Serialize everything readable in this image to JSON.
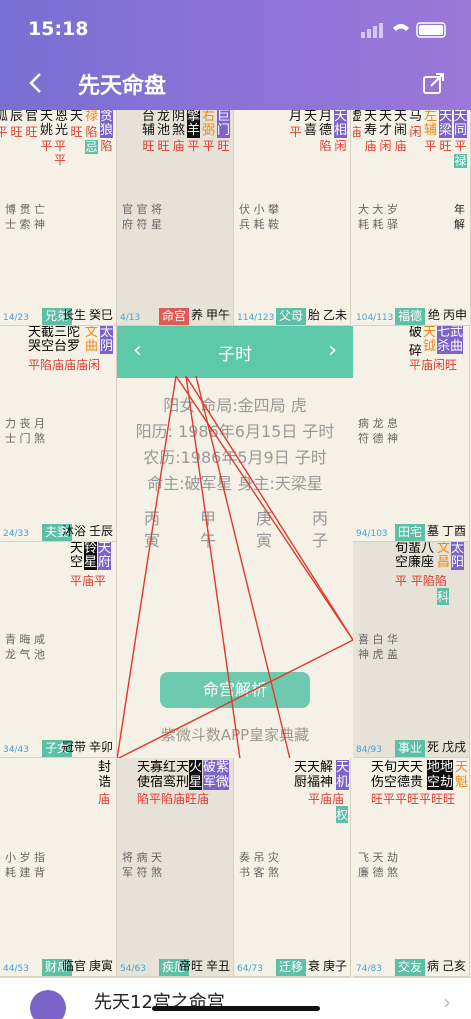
{
  "status": {
    "time": "15:18"
  },
  "nav": {
    "title": "先天命盘"
  },
  "cells": [
    {
      "id": "si",
      "col": 0,
      "row": 0,
      "dark": false,
      "stars": [
        {
          "n": "贪狼",
          "b": "陷",
          "cls": "hl"
        },
        {
          "n": "禄",
          "b": "陷",
          "cls": "org",
          "ex": "忌"
        },
        {
          "n": "天",
          "b": "旺"
        },
        {
          "n": "恩光",
          "b": "平平"
        },
        {
          "n": "天姚",
          "b": "平"
        },
        {
          "n": "官",
          "b": "旺"
        },
        {
          "n": "辰",
          "b": "旺"
        },
        {
          "n": "孤",
          "b": "平"
        },
        {
          "n": "巫",
          "b": "陷"
        }
      ],
      "gods": [
        "博 贯 亡",
        "士 索 神"
      ],
      "rgods": [],
      "age": "14/23",
      "palace": "兄弟",
      "state": "长生",
      "gz": "癸巳"
    },
    {
      "id": "wu",
      "col": 1,
      "row": 0,
      "dark": true,
      "stars": [
        {
          "n": "巨门",
          "b": "旺",
          "cls": "hl"
        },
        {
          "n": "右弼",
          "b": "平",
          "cls": "org"
        },
        {
          "n": "擎羊",
          "b": "平",
          "cls": "dk"
        },
        {
          "n": "阴煞",
          "b": "庙"
        },
        {
          "n": "龙池",
          "b": "旺"
        },
        {
          "n": "台辅",
          "b": "旺"
        }
      ],
      "gods": [
        "官 官 将",
        "府 符 星"
      ],
      "rgods": [],
      "age": "4/13",
      "palace": "命宫",
      "life": true,
      "state": "养",
      "gz": "甲午"
    },
    {
      "id": "wei",
      "col": 2,
      "row": 0,
      "dark": false,
      "stars": [
        {
          "n": "天相",
          "b": "闲",
          "cls": "hl"
        },
        {
          "n": "月德",
          "b": "陷"
        },
        {
          "n": "天喜",
          "b": ""
        },
        {
          "n": "月",
          "b": "平"
        }
      ],
      "gods": [
        "伏 小 攀",
        "兵 耗 鞍"
      ],
      "rgods": [],
      "age": "114/123",
      "palace": "父母",
      "state": "胎",
      "gz": "乙未"
    },
    {
      "id": "shen",
      "col": 3,
      "row": 0,
      "dark": false,
      "stars": [
        {
          "n": "天同",
          "b": "平",
          "cls": "hl",
          "ex": "禄"
        },
        {
          "n": "天梁",
          "b": "旺",
          "cls": "hl"
        },
        {
          "n": "左辅",
          "b": "平",
          "cls": "org"
        },
        {
          "n": "马",
          "b": "闲"
        },
        {
          "n": "天闹",
          "b": "庙"
        },
        {
          "n": "天才",
          "b": "闲"
        },
        {
          "n": "天寿",
          "b": "庙"
        },
        {
          "n": "虚",
          "b": "庙"
        }
      ],
      "gods": [
        "大 大 岁",
        "耗 耗 驿"
      ],
      "rgods": [
        "年",
        "解"
      ],
      "age": "104/113",
      "palace": "福德",
      "state": "绝",
      "gz": "丙申"
    }
  ],
  "center": {
    "hour": "子时",
    "l1": "阳女 命局:金四局 虎",
    "l2": "阳历:  1986年6月15日 子时",
    "l3": "农历:1986年5月9日 子时",
    "l4": "命主:破军星 身主:天梁星",
    "pillars": [
      [
        "丙",
        "寅"
      ],
      [
        "甲",
        "午"
      ],
      [
        "庚",
        "寅"
      ],
      [
        "丙",
        "子"
      ]
    ],
    "button": "命宫解析",
    "brand": "紫微斗数APP皇家典藏"
  },
  "bottom": {
    "text": "先天12宫之命宫"
  },
  "colors": {
    "accent": "#7b63c9",
    "teal": "#5dbfa5",
    "red": "#e03a2e"
  }
}
